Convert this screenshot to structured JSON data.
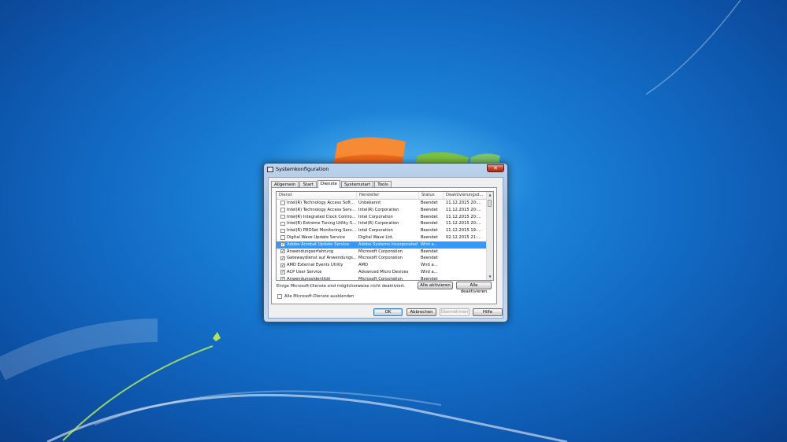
{
  "window": {
    "title": "Systemkonfiguration",
    "close_glyph": "✕"
  },
  "tabs": [
    "Allgemein",
    "Start",
    "Dienste",
    "Systemstart",
    "Tools"
  ],
  "active_tab": "Dienste",
  "columns": [
    "Dienst",
    "Hersteller",
    "Status",
    "Deaktivierungsd..."
  ],
  "services": [
    {
      "checked": false,
      "name": "Intel(R) Technology Access Soft...",
      "vendor": "Unbekannt",
      "status": "Beendet",
      "date": "11.12.2015 20:..."
    },
    {
      "checked": false,
      "name": "Intel(R) Technology Access Serv...",
      "vendor": "Intel(R) Corporation",
      "status": "Beendet",
      "date": "11.12.2015 20:..."
    },
    {
      "checked": false,
      "name": "Intel(R) Integrated Clock Contro...",
      "vendor": "Intel Corporation",
      "status": "Beendet",
      "date": "11.12.2015 20:..."
    },
    {
      "checked": false,
      "name": "Intel(R) Extreme Tuning Utility S...",
      "vendor": "Intel(R) Corporation",
      "status": "Beendet",
      "date": "11.12.2015 20:..."
    },
    {
      "checked": false,
      "name": "Intel(R) PROSet Monitoring Service",
      "vendor": "Intel Corporation",
      "status": "Beendet",
      "date": "11.12.2015 19:..."
    },
    {
      "checked": false,
      "name": "Digital Wave Update Service",
      "vendor": "Digital Wave Ltd.",
      "status": "Beendet",
      "date": "02.12.2015 21:..."
    },
    {
      "checked": true,
      "selected": true,
      "name": "Adobe Acrobat Update Service",
      "vendor": "Adobe Systems Incorporated",
      "status": "Wird a...",
      "date": ""
    },
    {
      "checked": true,
      "name": "Anwendungserfahrung",
      "vendor": "Microsoft Corporation",
      "status": "Beendet",
      "date": ""
    },
    {
      "checked": true,
      "name": "Gatewaydienst auf Anwendungs...",
      "vendor": "Microsoft Corporation",
      "status": "Beendet",
      "date": ""
    },
    {
      "checked": true,
      "name": "AMD External Events Utility",
      "vendor": "AMD",
      "status": "Wird a...",
      "date": ""
    },
    {
      "checked": true,
      "name": "ACP User Service",
      "vendor": "Advanced Micro Devices",
      "status": "Wird a...",
      "date": ""
    },
    {
      "checked": true,
      "name": "Anwendungsidentität",
      "vendor": "Microsoft Corporation",
      "status": "Beendet",
      "date": ""
    }
  ],
  "note": "Einige Microsoft-Dienste sind möglicherweise nicht deaktiviert.",
  "buttons": {
    "enable_all": "Alle aktivieren",
    "disable_all": "Alle deaktivieren",
    "ok": "OK",
    "cancel": "Abbrechen",
    "apply": "Übernehmen",
    "help": "Hilfe"
  },
  "hide_ms_label": "Alle Microsoft-Dienste ausblenden",
  "hide_ms_checked": false,
  "colors": {
    "selection": "#3399ff",
    "desktop": "#1676cf"
  }
}
